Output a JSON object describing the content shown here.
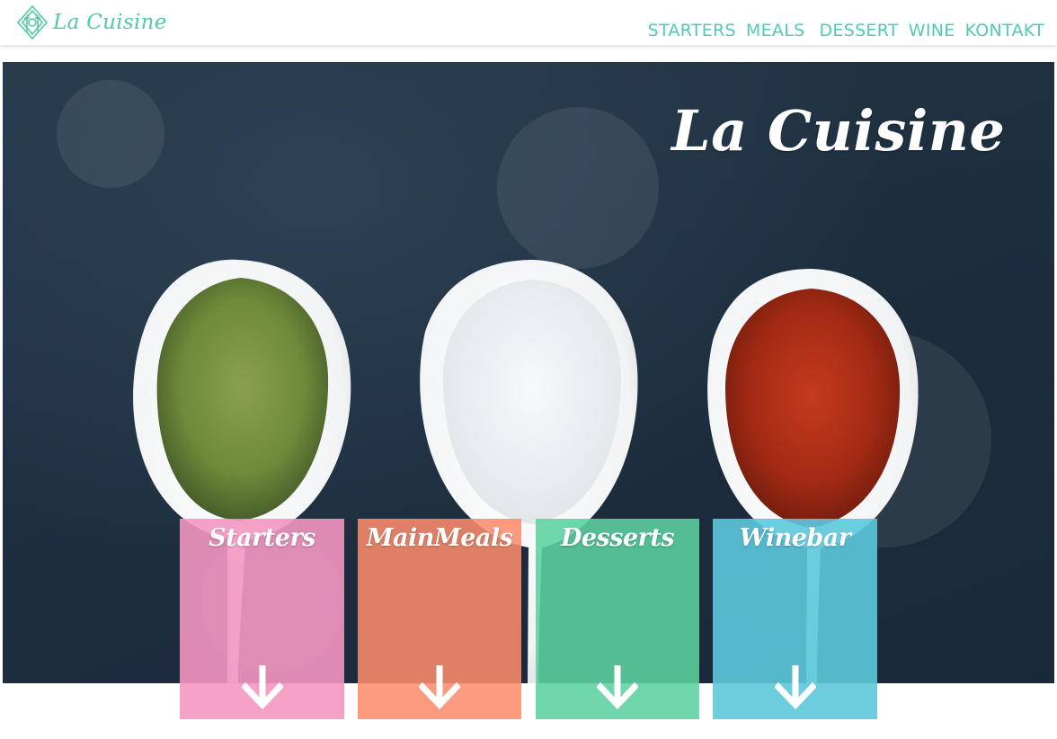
{
  "header": {
    "logo_text": "La Cuisine",
    "nav": [
      "STARTERS",
      "MEALS",
      "DESSERT",
      "WINE",
      "KONTAKT"
    ]
  },
  "hero": {
    "title": "La Cuisine"
  },
  "cards": [
    {
      "label": "Starters",
      "color": "#f396c1",
      "icon": "down-arrow-icon"
    },
    {
      "label": "MainMeals",
      "color": "#fa8c6c",
      "icon": "down-arrow-icon"
    },
    {
      "label": "Desserts",
      "color": "#5cd2a0",
      "icon": "down-arrow-icon"
    },
    {
      "label": "Winebar",
      "color": "#5cc8dc",
      "icon": "down-arrow-icon"
    }
  ],
  "colors": {
    "accent": "#52c9b8",
    "hero_background": "#1e2f40"
  }
}
